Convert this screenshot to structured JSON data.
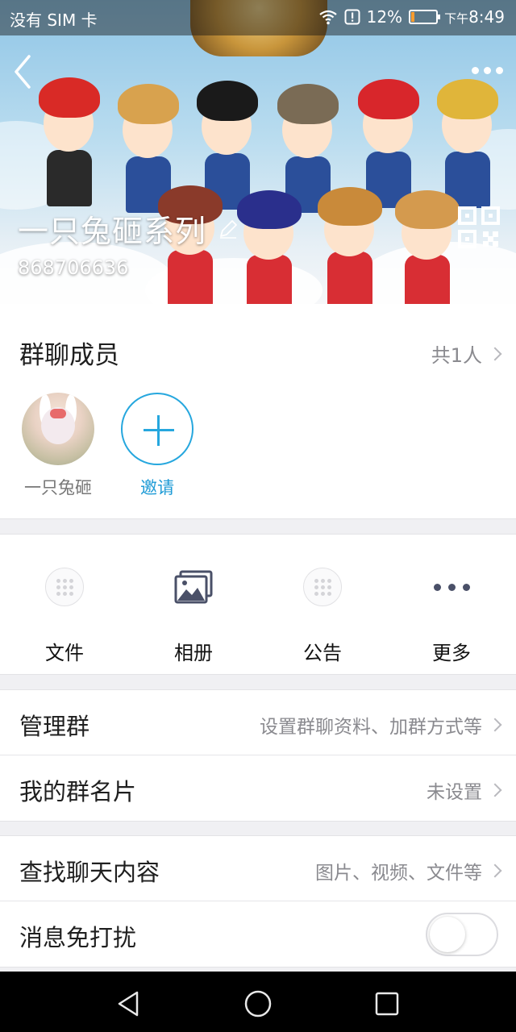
{
  "status_bar": {
    "carrier": "没有 SIM 卡",
    "battery_percent": "12%",
    "ampm": "下午",
    "time": "8:49",
    "icons": [
      "wifi-icon",
      "alert-icon",
      "battery-icon"
    ],
    "battery_level": 0.12
  },
  "header": {
    "group_name": "一只兔砸系列",
    "group_id": "868706636",
    "icons": [
      "back-arrow-icon",
      "more-dots-icon",
      "edit-pencil-icon",
      "qr-code-icon"
    ]
  },
  "members": {
    "title": "群聊成员",
    "count_label": "共1人",
    "list": [
      {
        "name": "一只兔砸"
      }
    ],
    "invite_label": "邀请"
  },
  "quick_actions": [
    {
      "label": "文件",
      "icon": "file-dotgrid-icon"
    },
    {
      "label": "相册",
      "icon": "album-icon"
    },
    {
      "label": "公告",
      "icon": "notice-dotgrid-icon"
    },
    {
      "label": "更多",
      "icon": "more-dots-icon"
    }
  ],
  "settings": {
    "manage_group": {
      "label": "管理群",
      "value": "设置群聊资料、加群方式等"
    },
    "my_card": {
      "label": "我的群名片",
      "value": "未设置"
    },
    "search_chat": {
      "label": "查找聊天内容",
      "value": "图片、视频、文件等"
    },
    "do_not_disturb": {
      "label": "消息免打扰",
      "enabled": false
    }
  },
  "colors": {
    "accent": "#1e9bd6",
    "background": "#f0f0f3"
  }
}
